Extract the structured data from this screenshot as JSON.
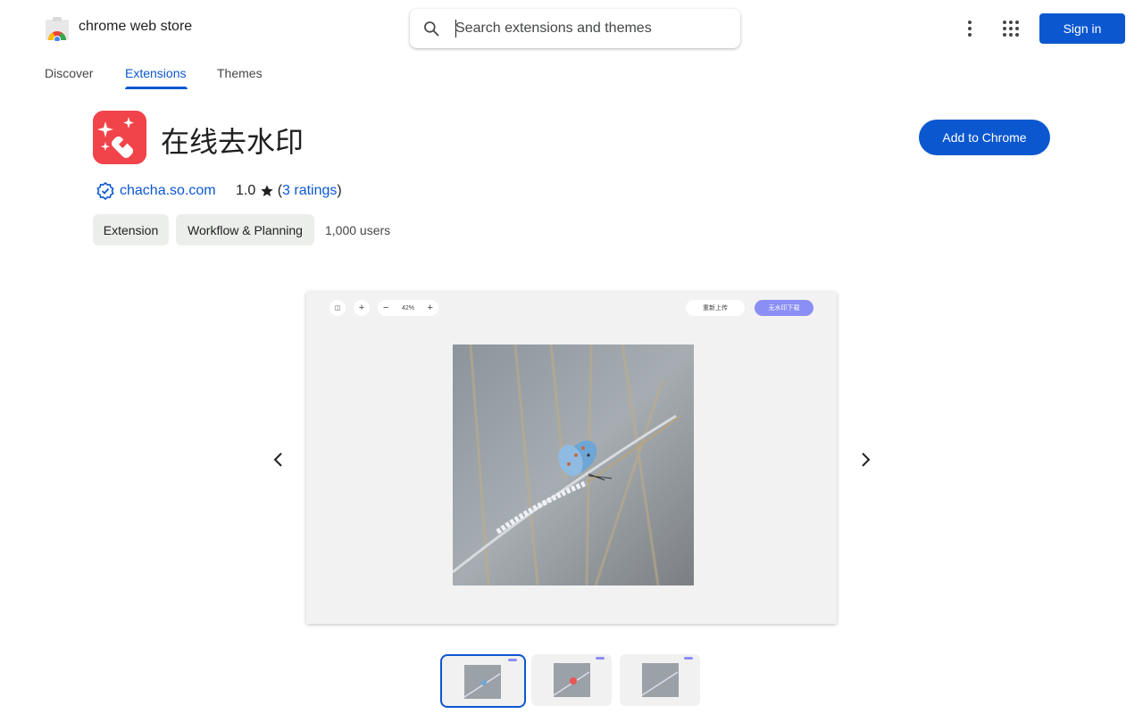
{
  "header": {
    "brand": "chrome web store",
    "search_placeholder": "Search extensions and themes",
    "sign_in": "Sign in"
  },
  "nav": {
    "tabs": [
      {
        "label": "Discover",
        "active": false
      },
      {
        "label": "Extensions",
        "active": true
      },
      {
        "label": "Themes",
        "active": false
      }
    ]
  },
  "extension": {
    "title": "在线去水印",
    "add_button": "Add to Chrome",
    "publisher": "chacha.so.com",
    "rating_value": "1.0",
    "ratings_prefix": " (",
    "ratings_link": "3 ratings",
    "ratings_suffix": ")",
    "chips": [
      "Extension",
      "Workflow & Planning"
    ],
    "users": "1,000 users"
  },
  "screenshot": {
    "zoom_label": "42%",
    "reupload_label": "重新上传",
    "download_label": "无水印下载"
  },
  "colors": {
    "accent": "#0b57d0",
    "icon_bg": "#f1434a",
    "chip_bg": "#eceeec"
  },
  "icons": [
    "search-icon",
    "more-vert-icon",
    "apps-grid-icon",
    "verified-icon",
    "star-icon",
    "chevron-left-icon",
    "chevron-right-icon"
  ]
}
